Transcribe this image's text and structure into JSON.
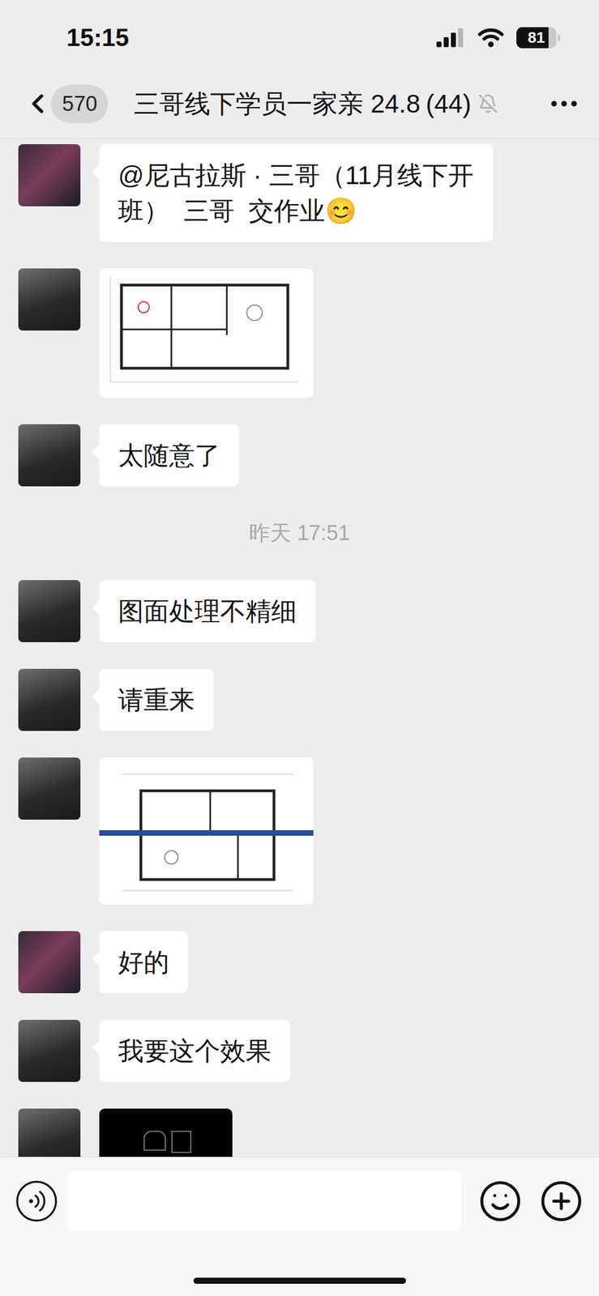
{
  "status_bar": {
    "time": "15:15",
    "battery": "81",
    "battery_level": 0.81,
    "signal_level": 0.75
  },
  "header": {
    "back_count": "570",
    "title": "三哥线下学员一家亲 24.8",
    "member_count": "(44)",
    "muted": true
  },
  "messages": [
    {
      "kind": "text",
      "sender": "student",
      "text": "@尼古拉斯 · 三哥（11月线下开班）  三哥  交作业😊"
    },
    {
      "kind": "plan",
      "sender": "teacher"
    },
    {
      "kind": "text",
      "sender": "teacher",
      "text": "太随意了"
    },
    {
      "kind": "time",
      "text": "昨天 17:51"
    },
    {
      "kind": "text",
      "sender": "teacher",
      "text": "图面处理不精细"
    },
    {
      "kind": "text",
      "sender": "teacher",
      "text": "请重来"
    },
    {
      "kind": "plan-banner",
      "sender": "teacher"
    },
    {
      "kind": "text",
      "sender": "student",
      "text": "好的"
    },
    {
      "kind": "text",
      "sender": "teacher",
      "text": "我要这个效果"
    },
    {
      "kind": "dark-image",
      "sender": "teacher"
    }
  ],
  "composer": {
    "text": ""
  }
}
